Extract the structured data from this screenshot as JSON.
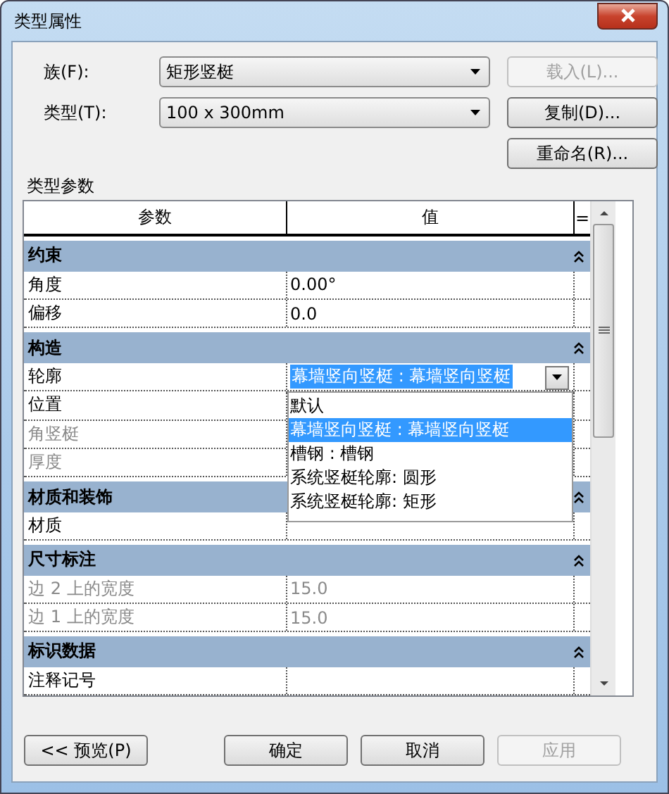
{
  "window": {
    "title": "类型属性"
  },
  "fields": [
    {
      "label": "族(F):",
      "value": "矩形竖梃"
    },
    {
      "label": "类型(T):",
      "value": "100 x 300mm"
    }
  ],
  "side_buttons": [
    {
      "label": "载入(L)...",
      "disabled": true
    },
    {
      "label": "复制(D)...",
      "disabled": false
    },
    {
      "label": "重命名(R)...",
      "disabled": false
    }
  ],
  "section_label": "类型参数",
  "table": {
    "columns": [
      "参数",
      "值",
      "="
    ],
    "groups": [
      {
        "name": "约束",
        "expanded": true,
        "rows": [
          {
            "name": "角度",
            "value": "0.00°",
            "disabled": false
          },
          {
            "name": "偏移",
            "value": "0.0",
            "disabled": false
          }
        ]
      },
      {
        "name": "构造",
        "expanded": true,
        "rows": [
          {
            "name": "轮廓",
            "value": "幕墙竖向竖梃 : 幕墙竖向竖梃",
            "disabled": false,
            "kind": "combo",
            "dropdown": [
              {
                "label": "默认",
                "selected": false
              },
              {
                "label": "幕墙竖向竖梃 : 幕墙竖向竖梃",
                "selected": true
              },
              {
                "label": "槽钢 : 槽钢",
                "selected": false
              },
              {
                "label": "系统竖梃轮廓: 圆形",
                "selected": false
              },
              {
                "label": "系统竖梃轮廓: 矩形",
                "selected": false
              }
            ]
          },
          {
            "name": "位置",
            "disabled": false
          },
          {
            "name": "角竖梃",
            "disabled": true
          },
          {
            "name": "厚度",
            "disabled": true
          }
        ]
      },
      {
        "name": "材质和装饰",
        "expanded": true,
        "rows": [
          {
            "name": "材质",
            "disabled": false
          }
        ]
      },
      {
        "name": "尺寸标注",
        "expanded": true,
        "rows": [
          {
            "name": "边 2 上的宽度",
            "value": "15.0",
            "disabled": true
          },
          {
            "name": "边 1 上的宽度",
            "value": "15.0",
            "disabled": true
          }
        ]
      },
      {
        "name": "标识数据",
        "expanded": true,
        "rows": [
          {
            "name": "注释记号",
            "disabled": false
          }
        ]
      }
    ]
  },
  "footer_buttons": [
    {
      "label": "<< 预览(P)",
      "disabled": false
    },
    {
      "label": "确定",
      "disabled": false
    },
    {
      "label": "取消",
      "disabled": false
    },
    {
      "label": "应用",
      "disabled": true
    }
  ]
}
